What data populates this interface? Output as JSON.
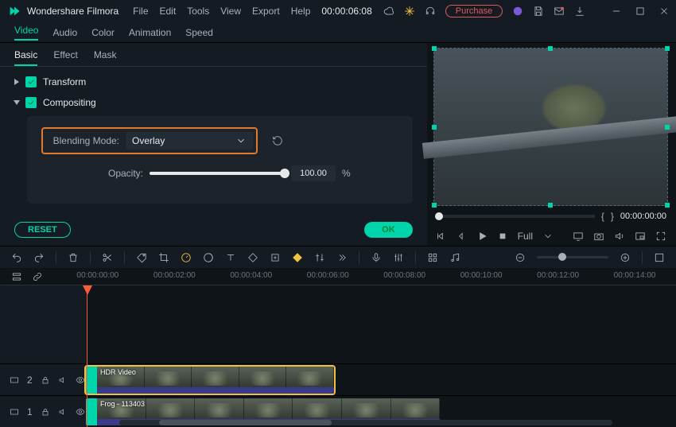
{
  "app": {
    "title": "Wondershare Filmora"
  },
  "menu": [
    "File",
    "Edit",
    "Tools",
    "View",
    "Export",
    "Help"
  ],
  "titlebar": {
    "timecode": "00:00:06:08",
    "purchase": "Purchase"
  },
  "tabs2": {
    "items": [
      "Video",
      "Audio",
      "Color",
      "Animation",
      "Speed"
    ],
    "active": 0
  },
  "tabs3": {
    "items": [
      "Basic",
      "Effect",
      "Mask"
    ],
    "active": 0
  },
  "groups": {
    "transform": {
      "label": "Transform",
      "checked": true,
      "open": false
    },
    "compositing": {
      "label": "Compositing",
      "checked": true,
      "open": true
    }
  },
  "compositing": {
    "mode_label": "Blending Mode:",
    "mode_value": "Overlay",
    "opacity_label": "Opacity:",
    "opacity_value": "100.00",
    "opacity_pct": 100,
    "unit": "%"
  },
  "buttons": {
    "reset": "RESET",
    "ok": "OK"
  },
  "preview": {
    "brackets_left": "{",
    "brackets_right": "}",
    "timecode": "00:00:00:00",
    "quality": "Full"
  },
  "ruler": {
    "ticks": [
      "00:00:00:00",
      "00:00:02:00",
      "00:00:04:00",
      "00:00:06:00",
      "00:00:08:00",
      "00:00:10:00",
      "00:00:12:00",
      "00:00:14:00"
    ],
    "playhead_at_tc": "00:00:00:00"
  },
  "tracks": {
    "t2": {
      "name": "2",
      "clip_title": "HDR Video",
      "selected": true
    },
    "t1": {
      "name": "1",
      "clip_title": "Frog - 113403",
      "selected": false
    }
  }
}
